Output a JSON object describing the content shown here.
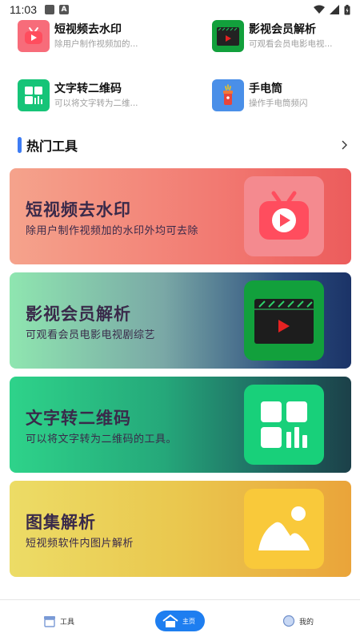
{
  "status_bar": {
    "time": "11:03"
  },
  "tools": [
    {
      "name": "短视频去水印",
      "desc": "除用户制作视频加的..."
    },
    {
      "name": "影视会员解析",
      "desc": "可观看会员电影电视..."
    },
    {
      "name": "文字转二维码",
      "desc": "可以将文字转为二维..."
    },
    {
      "name": "手电筒",
      "desc": "操作手电筒频闪"
    }
  ],
  "section": {
    "title": "热门工具"
  },
  "cards": [
    {
      "title": "短视频去水印",
      "subtitle": "除用户制作视频加的水印外均可去除"
    },
    {
      "title": "影视会员解析",
      "subtitle": "可观看会员电影电视剧综艺"
    },
    {
      "title": "文字转二维码",
      "subtitle": "可以将文字转为二维码的工具。"
    },
    {
      "title": "图集解析",
      "subtitle": "短视频软件内图片解析"
    }
  ],
  "bottom_nav": {
    "tools_label": "工具",
    "home_label": "主页",
    "mine_label": "我的"
  },
  "colors": {
    "accent": "#1e7ef0",
    "section_bar": "#3d7cf4"
  }
}
